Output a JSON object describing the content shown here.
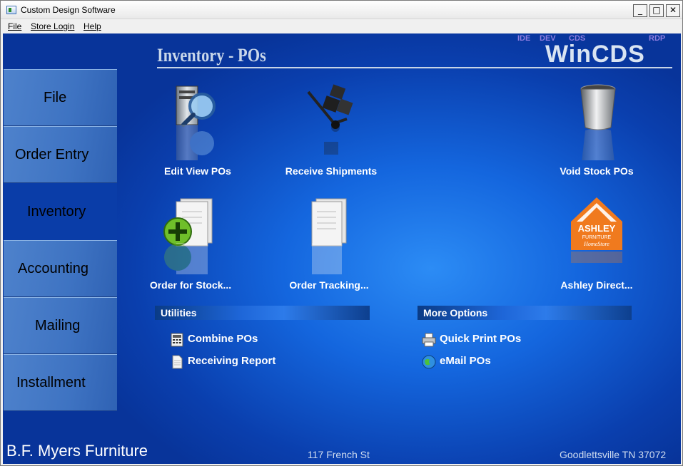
{
  "window": {
    "title": "Custom Design Software",
    "min_label": "_",
    "max_label": "□",
    "close_label": "✕"
  },
  "menu": {
    "items": [
      "File",
      "Store Login",
      "Help"
    ]
  },
  "header": {
    "page_title": "Inventory - POs",
    "tags": [
      "IDE",
      "DEV",
      "CDS",
      "RDP"
    ],
    "brand": "WinCDS"
  },
  "nav": {
    "tabs": [
      "File",
      "Order Entry",
      "Inventory",
      "Accounting",
      "Mailing",
      "Installment"
    ],
    "active": "Inventory"
  },
  "tiles": [
    {
      "label": "Edit View POs",
      "icon": "computer-magnifier-icon"
    },
    {
      "label": "Receive Shipments",
      "icon": "hand-truck-icon"
    },
    {
      "label": "Void Stock POs",
      "icon": "trash-can-icon"
    },
    {
      "label": "Order for Stock...",
      "icon": "document-add-icon"
    },
    {
      "label": "Order Tracking...",
      "icon": "documents-icon"
    },
    {
      "label": "Ashley Direct...",
      "icon": "ashley-logo-icon"
    }
  ],
  "ashley_logo": {
    "line1": "ASHLEY",
    "line2": "FURNITURE",
    "line3": "HomeStore"
  },
  "utilities": {
    "title": "Utilities",
    "items": [
      {
        "label": "Combine POs",
        "icon": "calculator-icon"
      },
      {
        "label": "Receiving Report",
        "icon": "document-icon"
      }
    ]
  },
  "more_options": {
    "title": "More Options",
    "items": [
      {
        "label": "Quick Print POs",
        "icon": "printer-icon"
      },
      {
        "label": "eMail POs",
        "icon": "globe-icon"
      }
    ]
  },
  "footer": {
    "company": "B.F. Myers Furniture",
    "street": "117 French St",
    "city": "Goodlettsville TN 37072"
  },
  "colors": {
    "background_blue": "#1466de",
    "active_tab": "#0a3da8",
    "tab_blue": "#3e73c2",
    "tag_purple": "#8e7de0"
  }
}
